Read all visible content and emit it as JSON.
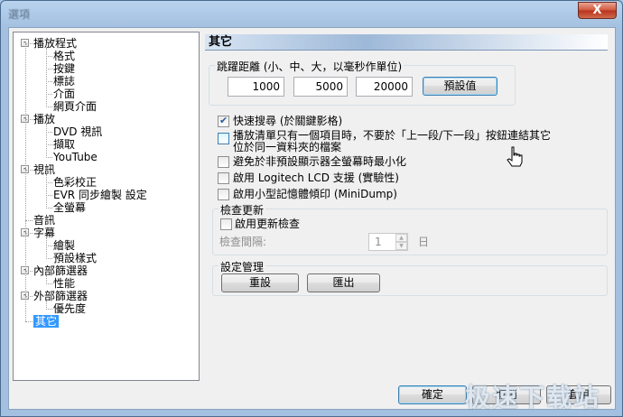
{
  "window": {
    "title": "選項",
    "close_label": "X"
  },
  "tree": {
    "items": [
      {
        "label": "播放程式",
        "expander": "-"
      },
      {
        "label": "格式"
      },
      {
        "label": "按鍵"
      },
      {
        "label": "標誌"
      },
      {
        "label": "介面"
      },
      {
        "label": "網頁介面"
      },
      {
        "label": "播放",
        "expander": "-"
      },
      {
        "label": "DVD 視訊"
      },
      {
        "label": "擷取"
      },
      {
        "label": "YouTube"
      },
      {
        "label": "視訊",
        "expander": "-"
      },
      {
        "label": "色彩校正"
      },
      {
        "label": "EVR 同步繪製 設定"
      },
      {
        "label": "全螢幕"
      },
      {
        "label": "音訊"
      },
      {
        "label": "字幕",
        "expander": "-"
      },
      {
        "label": "繪製"
      },
      {
        "label": "預設樣式"
      },
      {
        "label": "內部篩選器",
        "expander": "-"
      },
      {
        "label": "性能"
      },
      {
        "label": "外部篩選器",
        "expander": "-"
      },
      {
        "label": "優先度"
      },
      {
        "label": "其它",
        "selected": true
      }
    ]
  },
  "panel": {
    "title": "其它",
    "jump": {
      "label": "跳躍距離 (小、中、大，以毫秒作單位)",
      "small": "1000",
      "medium": "5000",
      "large": "20000",
      "default_button": "預設值"
    },
    "options": [
      {
        "label": "快速搜尋 (於關鍵影格)",
        "checked": true
      },
      {
        "label": "播放清單只有一個項目時，不要於「上一段/下一段」按鈕連結其它",
        "label2": "位於同一資料夾的檔案",
        "checked": false
      },
      {
        "label": "避免於非預設顯示器全螢幕時最小化",
        "checked": false
      },
      {
        "label": "啟用 Logitech LCD 支援 (實驗性)",
        "checked": false
      },
      {
        "label": "啟用小型記憶體傾印 (MiniDump)",
        "checked": false
      }
    ],
    "update": {
      "group_label": "檢查更新",
      "enable_label": "啟用更新檢查",
      "enable_checked": false,
      "interval_label": "檢查間隔:",
      "interval_value": "1",
      "interval_unit": "日"
    },
    "settings": {
      "group_label": "設定管理",
      "reset_button": "重設",
      "export_button": "匯出"
    }
  },
  "footer": {
    "ok": "確定",
    "cancel": "取消",
    "apply": "套用"
  },
  "watermark": "极速下载站"
}
